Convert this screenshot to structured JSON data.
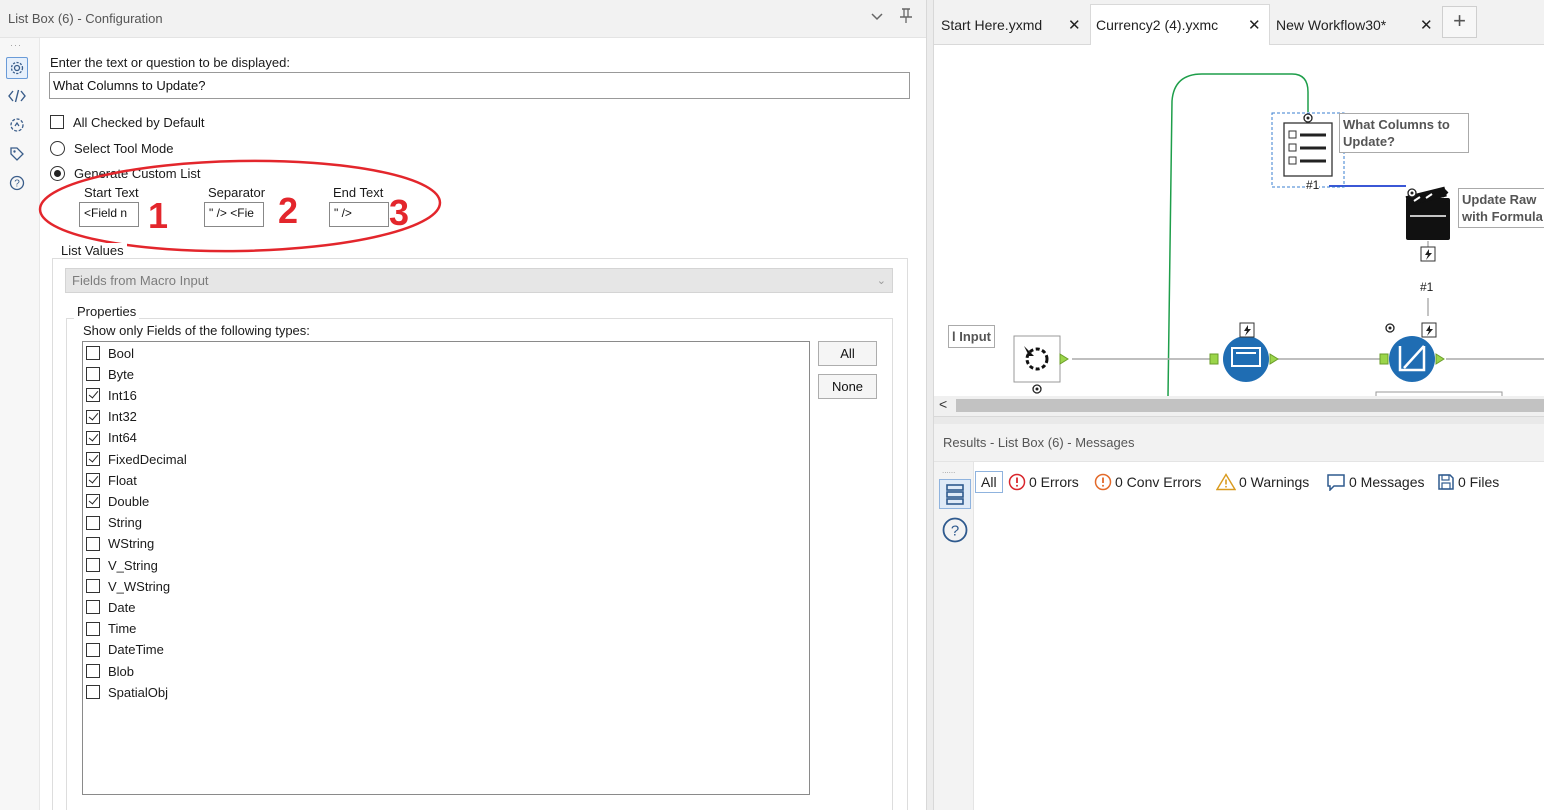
{
  "config": {
    "title": "List Box (6) - Configuration",
    "prompt_label": "Enter the text or question to be displayed:",
    "prompt_value": "What Columns to Update?",
    "all_checked_label": "All Checked by Default",
    "select_tool_mode_label": "Select Tool Mode",
    "generate_custom_label": "Generate Custom List",
    "start_text_label": "Start Text",
    "start_text_value": "<Field n",
    "separator_label": "Separator",
    "separator_value": "\" /> <Fie",
    "end_text_label": "End Text",
    "end_text_value": "\" />",
    "annotations": [
      "1",
      "2",
      "3"
    ],
    "list_values_label": "List Values",
    "source_select_value": "Fields from Macro Input",
    "properties_label": "Properties",
    "types_label": "Show only Fields of the following types:",
    "field_types": [
      {
        "label": "Bool",
        "checked": false
      },
      {
        "label": "Byte",
        "checked": false
      },
      {
        "label": "Int16",
        "checked": true
      },
      {
        "label": "Int32",
        "checked": true
      },
      {
        "label": "Int64",
        "checked": true
      },
      {
        "label": "FixedDecimal",
        "checked": true
      },
      {
        "label": "Float",
        "checked": true
      },
      {
        "label": "Double",
        "checked": true
      },
      {
        "label": "String",
        "checked": false
      },
      {
        "label": "WString",
        "checked": false
      },
      {
        "label": "V_String",
        "checked": false
      },
      {
        "label": "V_WString",
        "checked": false
      },
      {
        "label": "Date",
        "checked": false
      },
      {
        "label": "Time",
        "checked": false
      },
      {
        "label": "DateTime",
        "checked": false
      },
      {
        "label": "Blob",
        "checked": false
      },
      {
        "label": "SpatialObj",
        "checked": false
      }
    ],
    "all_button": "All",
    "none_button": "None"
  },
  "tabs": [
    {
      "label": "Start Here.yxmd",
      "active": false
    },
    {
      "label": "Currency2 (4).yxmc",
      "active": true
    },
    {
      "label": "New Workflow30*",
      "active": false
    }
  ],
  "canvas": {
    "list_box_label": "What Columns to\nUpdate?",
    "action_label": "Update Raw\nwith Formula",
    "input_label": "l Input",
    "connection_1": "#1",
    "connection_2": "#1"
  },
  "results": {
    "title": "Results - List Box (6) - Messages",
    "filters": {
      "all": "All",
      "errors": "0 Errors",
      "conv_errors": "0 Conv Errors",
      "warnings": "0 Warnings",
      "messages": "0 Messages",
      "files": "0 Files"
    }
  },
  "colors": {
    "annotation_red": "#e3262c",
    "tool_blue": "#1f6db3",
    "connector_green": "#1e9e4a",
    "connector_blue": "#1f3fd0"
  }
}
